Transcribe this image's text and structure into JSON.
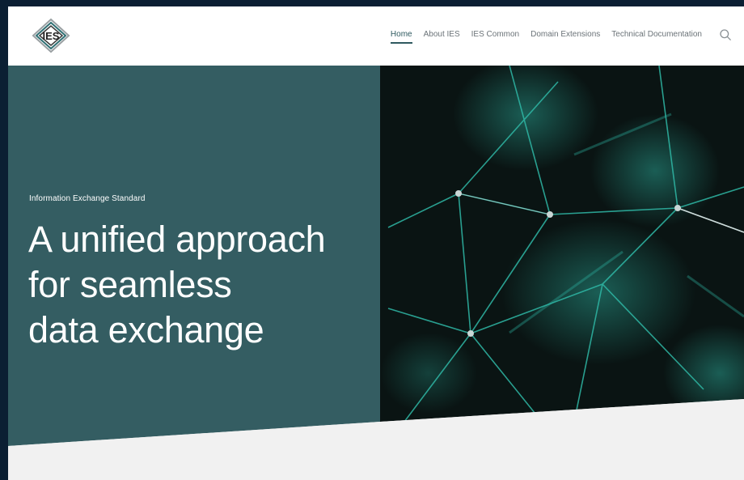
{
  "header": {
    "logo_text": "IES",
    "nav": [
      "Home",
      "About IES",
      "IES Common",
      "Domain Extensions",
      "Technical Documentation"
    ],
    "active_nav": "Home",
    "search_icon": "search-icon"
  },
  "hero": {
    "eyebrow": "Information Exchange Standard",
    "headline_lines": [
      "A unified approach",
      "for seamless",
      "data exchange"
    ],
    "panel_color": "#345d62",
    "accent_color": "#2fb8a6"
  }
}
